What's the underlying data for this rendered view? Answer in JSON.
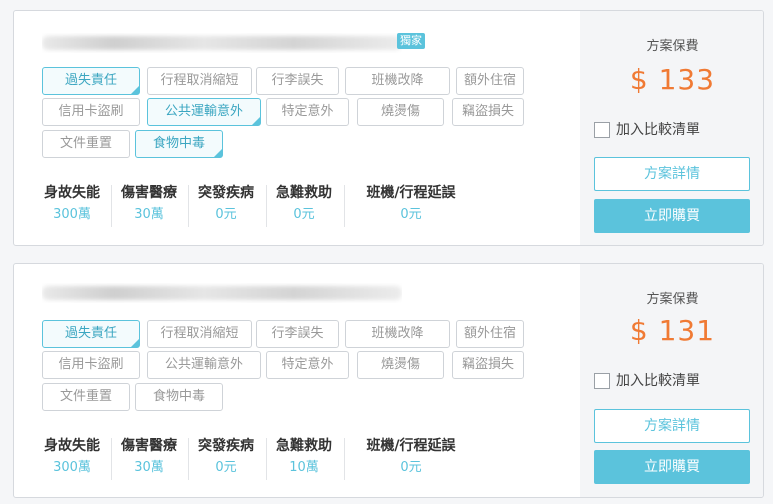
{
  "plans": [
    {
      "badge": "獨家",
      "tags": [
        {
          "label": "過失責任",
          "on": true
        },
        {
          "label": "行程取消縮短",
          "on": false
        },
        {
          "label": "行李誤失",
          "on": false
        },
        {
          "label": "班機改降",
          "on": false
        },
        {
          "label": "額外住宿",
          "on": false
        },
        {
          "label": "信用卡盜刷",
          "on": false
        },
        {
          "label": "公共運輸意外",
          "on": true
        },
        {
          "label": "特定意外",
          "on": false
        },
        {
          "label": "燒燙傷",
          "on": false
        },
        {
          "label": "竊盜損失",
          "on": false
        },
        {
          "label": "文件重置",
          "on": false
        },
        {
          "label": "食物中毒",
          "on": true
        }
      ],
      "stats": [
        {
          "label": "身故失能",
          "value": "300萬"
        },
        {
          "label": "傷害醫療",
          "value": "30萬"
        },
        {
          "label": "突發疾病",
          "value": "0元"
        },
        {
          "label": "急難救助",
          "value": "0元"
        },
        {
          "label": "班機/行程延誤",
          "value": "0元"
        }
      ],
      "plan_label": "方案保費",
      "price": "$ 133",
      "compare_label": "加入比較清單",
      "detail_label": "方案詳情",
      "buy_label": "立即購買"
    },
    {
      "badge": "",
      "tags": [
        {
          "label": "過失責任",
          "on": true
        },
        {
          "label": "行程取消縮短",
          "on": false
        },
        {
          "label": "行李誤失",
          "on": false
        },
        {
          "label": "班機改降",
          "on": false
        },
        {
          "label": "額外住宿",
          "on": false
        },
        {
          "label": "信用卡盜刷",
          "on": false
        },
        {
          "label": "公共運輸意外",
          "on": false
        },
        {
          "label": "特定意外",
          "on": false
        },
        {
          "label": "燒燙傷",
          "on": false
        },
        {
          "label": "竊盜損失",
          "on": false
        },
        {
          "label": "文件重置",
          "on": false
        },
        {
          "label": "食物中毒",
          "on": false
        }
      ],
      "stats": [
        {
          "label": "身故失能",
          "value": "300萬"
        },
        {
          "label": "傷害醫療",
          "value": "30萬"
        },
        {
          "label": "突發疾病",
          "value": "0元"
        },
        {
          "label": "急難救助",
          "value": "10萬"
        },
        {
          "label": "班機/行程延誤",
          "value": "0元"
        }
      ],
      "plan_label": "方案保費",
      "price": "$ 131",
      "compare_label": "加入比較清單",
      "detail_label": "方案詳情",
      "buy_label": "立即購買"
    }
  ]
}
